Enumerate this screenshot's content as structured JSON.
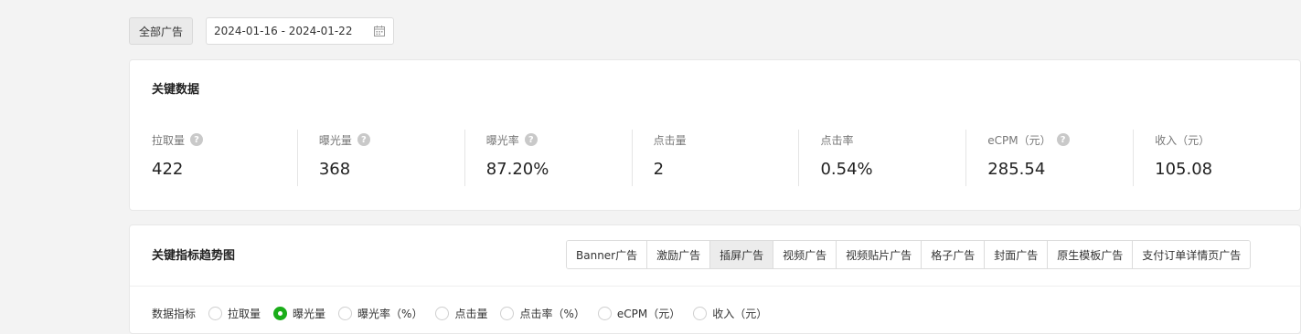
{
  "filter": {
    "all_ads_label": "全部广告",
    "date_range": "2024-01-16 - 2024-01-22",
    "calendar_icon": "calendar-icon"
  },
  "key_data": {
    "title": "关键数据",
    "metrics": [
      {
        "label": "拉取量",
        "value": "422",
        "help": true
      },
      {
        "label": "曝光量",
        "value": "368",
        "help": true
      },
      {
        "label": "曝光率",
        "value": "87.20%",
        "help": true
      },
      {
        "label": "点击量",
        "value": "2",
        "help": false
      },
      {
        "label": "点击率",
        "value": "0.54%",
        "help": false
      },
      {
        "label": "eCPM（元）",
        "value": "285.54",
        "help": true
      },
      {
        "label": "收入（元）",
        "value": "105.08",
        "help": false
      }
    ]
  },
  "trend": {
    "title": "关键指标趋势图",
    "tabs": [
      "Banner广告",
      "激励广告",
      "插屏广告",
      "视频广告",
      "视频贴片广告",
      "格子广告",
      "封面广告",
      "原生模板广告",
      "支付订单详情页广告"
    ],
    "active_tab": 2,
    "metric_label": "数据指标",
    "radio_options": [
      "拉取量",
      "曝光量",
      "曝光率（%）",
      "点击量",
      "点击率（%）",
      "eCPM（元）",
      "收入（元）"
    ],
    "selected_option": 1
  },
  "colors": {
    "accent": "#1aad19"
  }
}
